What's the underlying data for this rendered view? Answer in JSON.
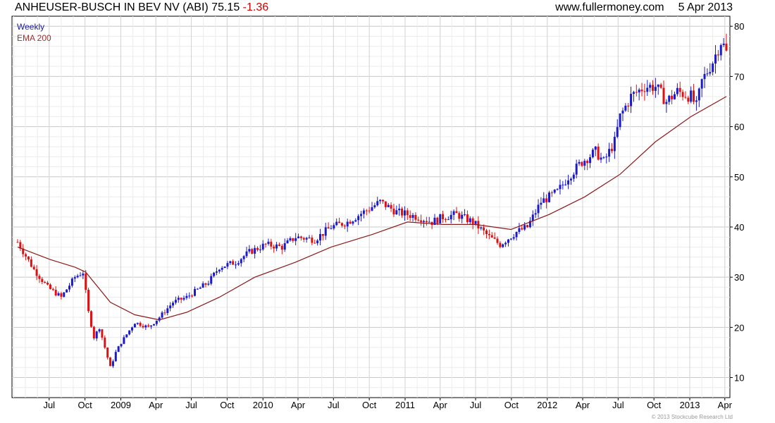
{
  "header": {
    "title": "ANHEUSER-BUSCH IN BEV NV (ABI)",
    "last": "75.15",
    "change": "-1.36",
    "site": "www.fullermoney.com",
    "date": "5 Apr 2013"
  },
  "legend": {
    "period": "Weekly",
    "indicator": "EMA 200"
  },
  "copyright": "© 2013 Stockcube Research Ltd",
  "colors": {
    "up": "#1a1acc",
    "down": "#dd1111",
    "ema": "#8b1a1a",
    "grid": "#d8d8d8",
    "legend_weekly": "#1a1a99",
    "legend_ema": "#993333"
  },
  "chart_data": {
    "type": "candlestick",
    "frequency": "weekly",
    "y_ticks": [
      10,
      20,
      30,
      40,
      50,
      60,
      70,
      80
    ],
    "ylim": [
      6,
      82
    ],
    "x_ticks": [
      "Jul",
      "Oct",
      "2009",
      "Apr",
      "Jul",
      "Oct",
      "2010",
      "Apr",
      "Jul",
      "Oct",
      "2011",
      "Apr",
      "Jul",
      "Oct",
      "2012",
      "Apr",
      "Jul",
      "Oct",
      "2013",
      "Apr"
    ],
    "close_path": [
      [
        "2008-04-11",
        37.0
      ],
      [
        "2008-05-23",
        31.5
      ],
      [
        "2008-06-27",
        28.0
      ],
      [
        "2008-08-01",
        26.0
      ],
      [
        "2008-09-05",
        30.0
      ],
      [
        "2008-09-26",
        31.0
      ],
      [
        "2008-10-10",
        23.0
      ],
      [
        "2008-10-24",
        18.0
      ],
      [
        "2008-11-07",
        20.0
      ],
      [
        "2008-11-21",
        16.0
      ],
      [
        "2008-12-05",
        12.0
      ],
      [
        "2008-12-19",
        15.0
      ],
      [
        "2009-01-02",
        17.0
      ],
      [
        "2009-02-06",
        21.0
      ],
      [
        "2009-03-13",
        20.0
      ],
      [
        "2009-04-10",
        22.0
      ],
      [
        "2009-05-15",
        25.0
      ],
      [
        "2009-06-19",
        26.0
      ],
      [
        "2009-08-14",
        29.0
      ],
      [
        "2009-09-11",
        32.0
      ],
      [
        "2009-10-23",
        33.0
      ],
      [
        "2009-11-27",
        35.0
      ],
      [
        "2010-01-08",
        36.5
      ],
      [
        "2010-02-19",
        36.0
      ],
      [
        "2010-03-26",
        38.0
      ],
      [
        "2010-05-14",
        37.5
      ],
      [
        "2010-06-25",
        40.0
      ],
      [
        "2010-08-06",
        41.0
      ],
      [
        "2010-09-17",
        43.0
      ],
      [
        "2010-10-29",
        45.0
      ],
      [
        "2010-12-10",
        43.0
      ],
      [
        "2011-02-04",
        42.0
      ],
      [
        "2011-03-11",
        41.0
      ],
      [
        "2011-04-08",
        42.0
      ],
      [
        "2011-05-13",
        42.5
      ],
      [
        "2011-06-24",
        41.0
      ],
      [
        "2011-08-05",
        38.0
      ],
      [
        "2011-09-02",
        36.5
      ],
      [
        "2011-10-14",
        39.0
      ],
      [
        "2011-11-11",
        40.0
      ],
      [
        "2011-12-16",
        45.0
      ],
      [
        "2012-01-27",
        47.0
      ],
      [
        "2012-02-24",
        50.0
      ],
      [
        "2012-03-30",
        53.0
      ],
      [
        "2012-05-04",
        55.0
      ],
      [
        "2012-05-25",
        53.0
      ],
      [
        "2012-06-22",
        57.0
      ],
      [
        "2012-07-06",
        62.0
      ],
      [
        "2012-08-03",
        66.0
      ],
      [
        "2012-09-07",
        68.0
      ],
      [
        "2012-10-05",
        68.0
      ],
      [
        "2012-11-02",
        65.0
      ],
      [
        "2012-11-30",
        67.0
      ],
      [
        "2013-01-04",
        66.0
      ],
      [
        "2013-01-18",
        64.0
      ],
      [
        "2013-02-01",
        69.0
      ],
      [
        "2013-03-01",
        73.0
      ],
      [
        "2013-03-22",
        77.0
      ],
      [
        "2013-04-05",
        75.15
      ]
    ],
    "ema200_path": [
      [
        "2008-04-11",
        36.0
      ],
      [
        "2008-07-04",
        33.5
      ],
      [
        "2008-09-05",
        32.0
      ],
      [
        "2008-10-03",
        31.0
      ],
      [
        "2008-12-05",
        25.0
      ],
      [
        "2009-02-06",
        22.5
      ],
      [
        "2009-04-10",
        21.5
      ],
      [
        "2009-06-19",
        23.0
      ],
      [
        "2009-09-11",
        26.0
      ],
      [
        "2009-12-11",
        30.0
      ],
      [
        "2010-03-26",
        33.0
      ],
      [
        "2010-06-25",
        36.0
      ],
      [
        "2010-10-08",
        38.5
      ],
      [
        "2011-01-07",
        41.0
      ],
      [
        "2011-04-08",
        40.5
      ],
      [
        "2011-07-01",
        40.5
      ],
      [
        "2011-09-30",
        39.5
      ],
      [
        "2012-01-06",
        42.5
      ],
      [
        "2012-04-06",
        46.0
      ],
      [
        "2012-07-06",
        50.5
      ],
      [
        "2012-10-05",
        57.0
      ],
      [
        "2013-01-04",
        62.0
      ],
      [
        "2013-04-05",
        66.0
      ]
    ]
  }
}
